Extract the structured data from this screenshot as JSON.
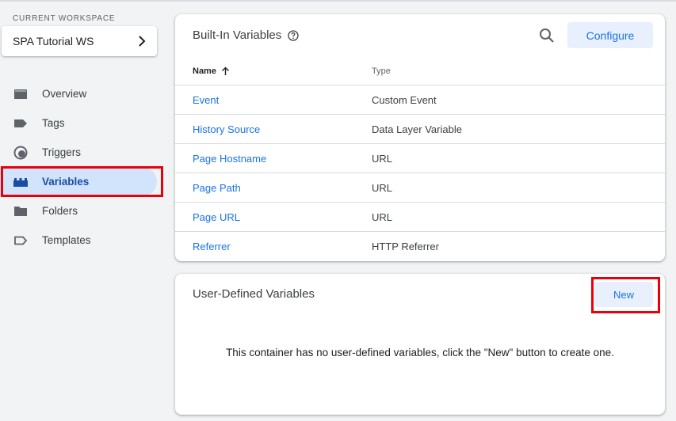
{
  "workspace": {
    "label": "CURRENT WORKSPACE",
    "name": "SPA Tutorial WS"
  },
  "nav": {
    "items": [
      {
        "label": "Overview",
        "icon": "overview-icon"
      },
      {
        "label": "Tags",
        "icon": "tag-icon"
      },
      {
        "label": "Triggers",
        "icon": "trigger-icon"
      },
      {
        "label": "Variables",
        "icon": "variables-icon",
        "active": true
      },
      {
        "label": "Folders",
        "icon": "folder-icon"
      },
      {
        "label": "Templates",
        "icon": "template-icon"
      }
    ]
  },
  "builtin": {
    "title": "Built-In Variables",
    "configure_label": "Configure",
    "columns": {
      "name": "Name",
      "type": "Type"
    },
    "rows": [
      {
        "name": "Event",
        "type": "Custom Event"
      },
      {
        "name": "History Source",
        "type": "Data Layer Variable"
      },
      {
        "name": "Page Hostname",
        "type": "URL"
      },
      {
        "name": "Page Path",
        "type": "URL"
      },
      {
        "name": "Page URL",
        "type": "URL"
      },
      {
        "name": "Referrer",
        "type": "HTTP Referrer"
      }
    ]
  },
  "user_defined": {
    "title": "User-Defined Variables",
    "new_label": "New",
    "empty_message": "This container has no user-defined variables, click the \"New\" button to create one."
  },
  "colors": {
    "accent": "#1a73e8",
    "active_bg": "#d2e3fc",
    "highlight": "#e8000b",
    "button_bg": "#e8f0fe"
  }
}
